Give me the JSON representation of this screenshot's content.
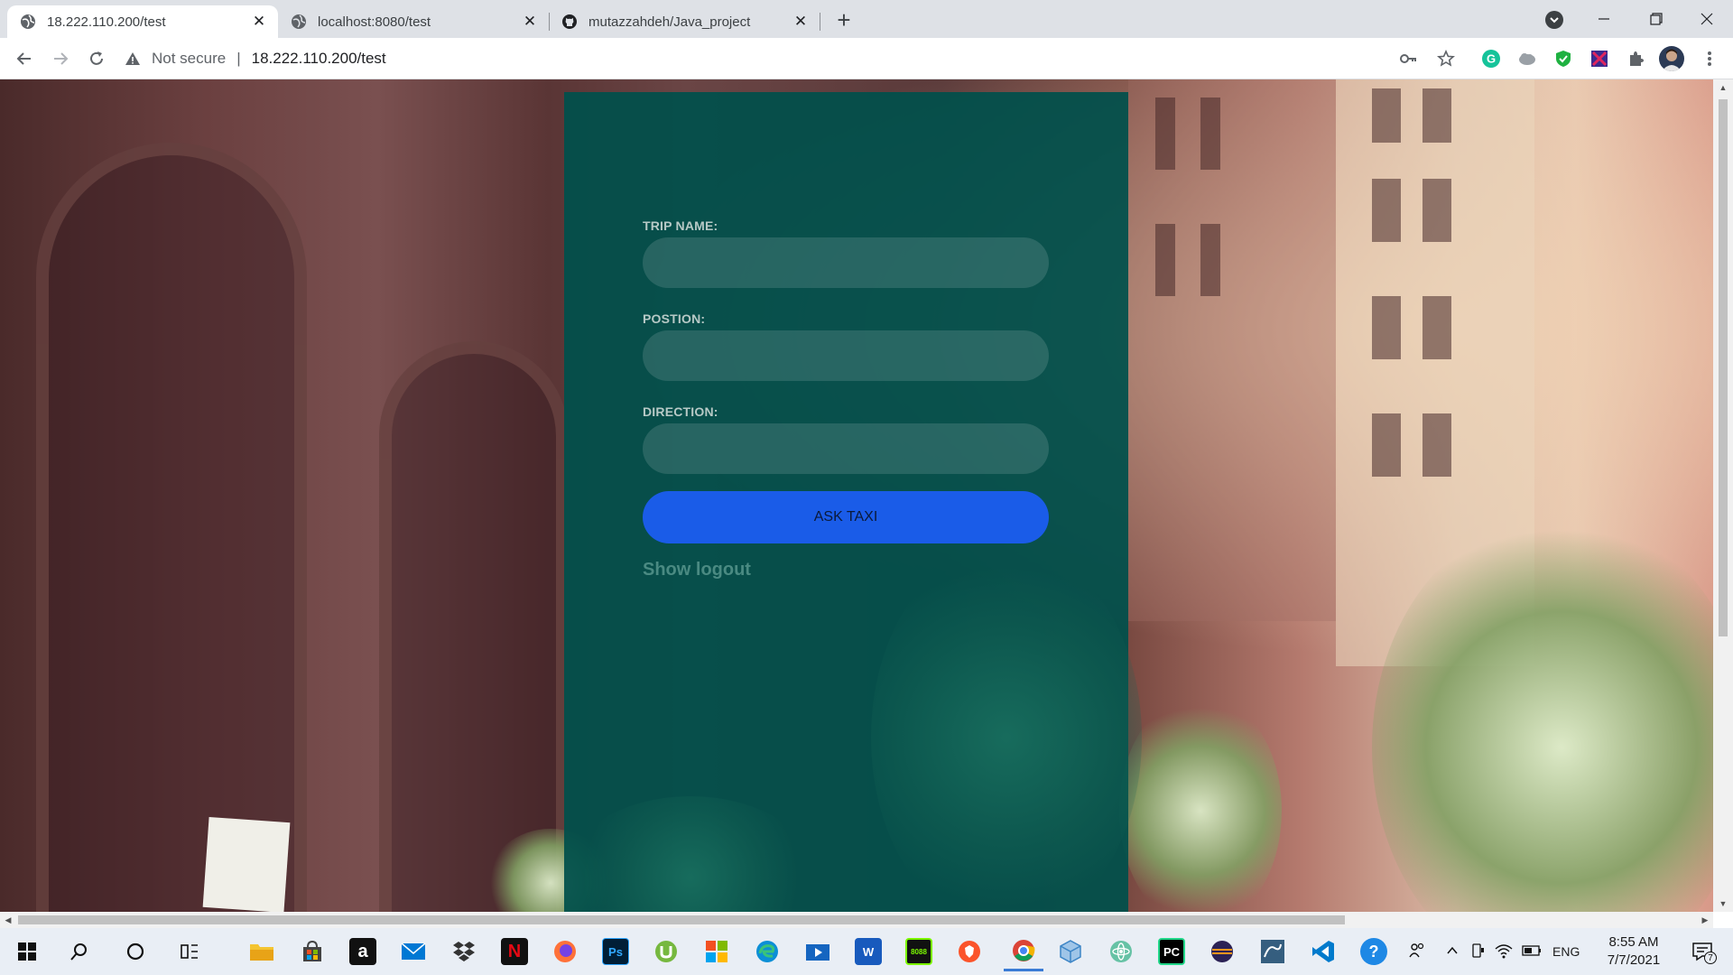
{
  "browser": {
    "tabs": [
      {
        "title": "18.222.110.200/test",
        "active": true,
        "icon": "globe-icon"
      },
      {
        "title": "localhost:8080/test",
        "active": false,
        "icon": "globe-icon"
      },
      {
        "title": "mutazzahdeh/Java_project",
        "active": false,
        "icon": "github-icon"
      }
    ],
    "new_tab_symbol": "+",
    "close_symbol": "✕",
    "security_label": "Not secure",
    "url": "18.222.110.200/test",
    "extension_icons": [
      "key-icon",
      "star-icon",
      "grammarly-icon",
      "cloud-icon",
      "shield-icon",
      "grid-icon",
      "puzzle-icon",
      "profile-avatar"
    ]
  },
  "form": {
    "trip_name_label": "TRIP NAME:",
    "position_label": "POSTION:",
    "direction_label": "DIRECTION:",
    "trip_name_value": "",
    "position_value": "",
    "direction_value": "",
    "submit_label": "ASK TAXI",
    "logout_label": "Show logout"
  },
  "colors": {
    "panel": "#00504b",
    "button": "#1a5ce8",
    "label": "#b7c9c6",
    "link": "#4a8a82"
  },
  "taskbar": {
    "apps": [
      "windows-start-icon",
      "search-icon",
      "cortana-icon",
      "task-view-icon",
      "file-explorer-icon",
      "store-icon",
      "amazon-icon",
      "mail-icon",
      "dropbox-icon",
      "netflix-icon",
      "firefox-icon",
      "photoshop-icon",
      "utorrent-icon",
      "office-icon",
      "edge-icon",
      "video-icon",
      "word-icon",
      "terminal-icon",
      "brave-icon",
      "chrome-icon",
      "cube-icon",
      "atom-icon",
      "pycharm-icon",
      "eclipse-icon",
      "mysql-icon",
      "vscode-icon",
      "help-icon"
    ],
    "tile_labels": {
      "amazon": "a",
      "netflix": "N",
      "photoshop": "Ps",
      "word": "W",
      "pycharm": "PC",
      "terminal": "8088",
      "help": "?"
    },
    "language": "ENG",
    "time": "8:55 AM",
    "date": "7/7/2021",
    "notification_count": "7"
  }
}
